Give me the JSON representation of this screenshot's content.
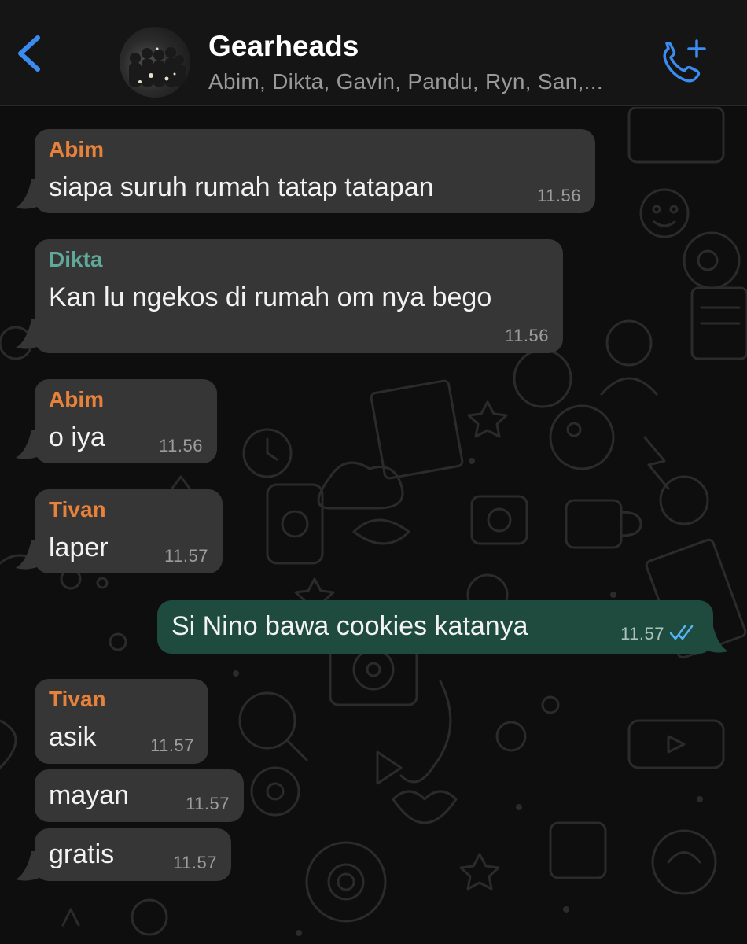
{
  "header": {
    "title": "Gearheads",
    "subtitle": "Abim, Dikta, Gavin, Pandu, Ryn, San,...",
    "back_icon": "chevron-left-icon",
    "call_icon": "add-call-icon",
    "accent": "#3b8cf0"
  },
  "colors": {
    "abim": "#e8813a",
    "dikta": "#5fa89a",
    "tivan": "#e8813a",
    "incoming_bubble": "#363636",
    "outgoing_bubble": "#1f4b3e",
    "read_ticks": "#56b4f5"
  },
  "messages": [
    {
      "sender": "Abim",
      "text": "siapa suruh rumah tatap tatapan",
      "time": "11.56"
    },
    {
      "sender": "Dikta",
      "text": "Kan lu ngekos di rumah om nya bego",
      "time": "11.56"
    },
    {
      "sender": "Abim",
      "text": "o iya",
      "time": "11.56"
    },
    {
      "sender": "Tivan",
      "text": "laper",
      "time": "11.57"
    },
    {
      "text": "Si Nino bawa cookies katanya",
      "time": "11.57",
      "status": "read"
    },
    {
      "sender": "Tivan",
      "text": "asik",
      "time": "11.57"
    },
    {
      "text": "mayan",
      "time": "11.57"
    },
    {
      "text": "gratis",
      "time": "11.57"
    }
  ]
}
